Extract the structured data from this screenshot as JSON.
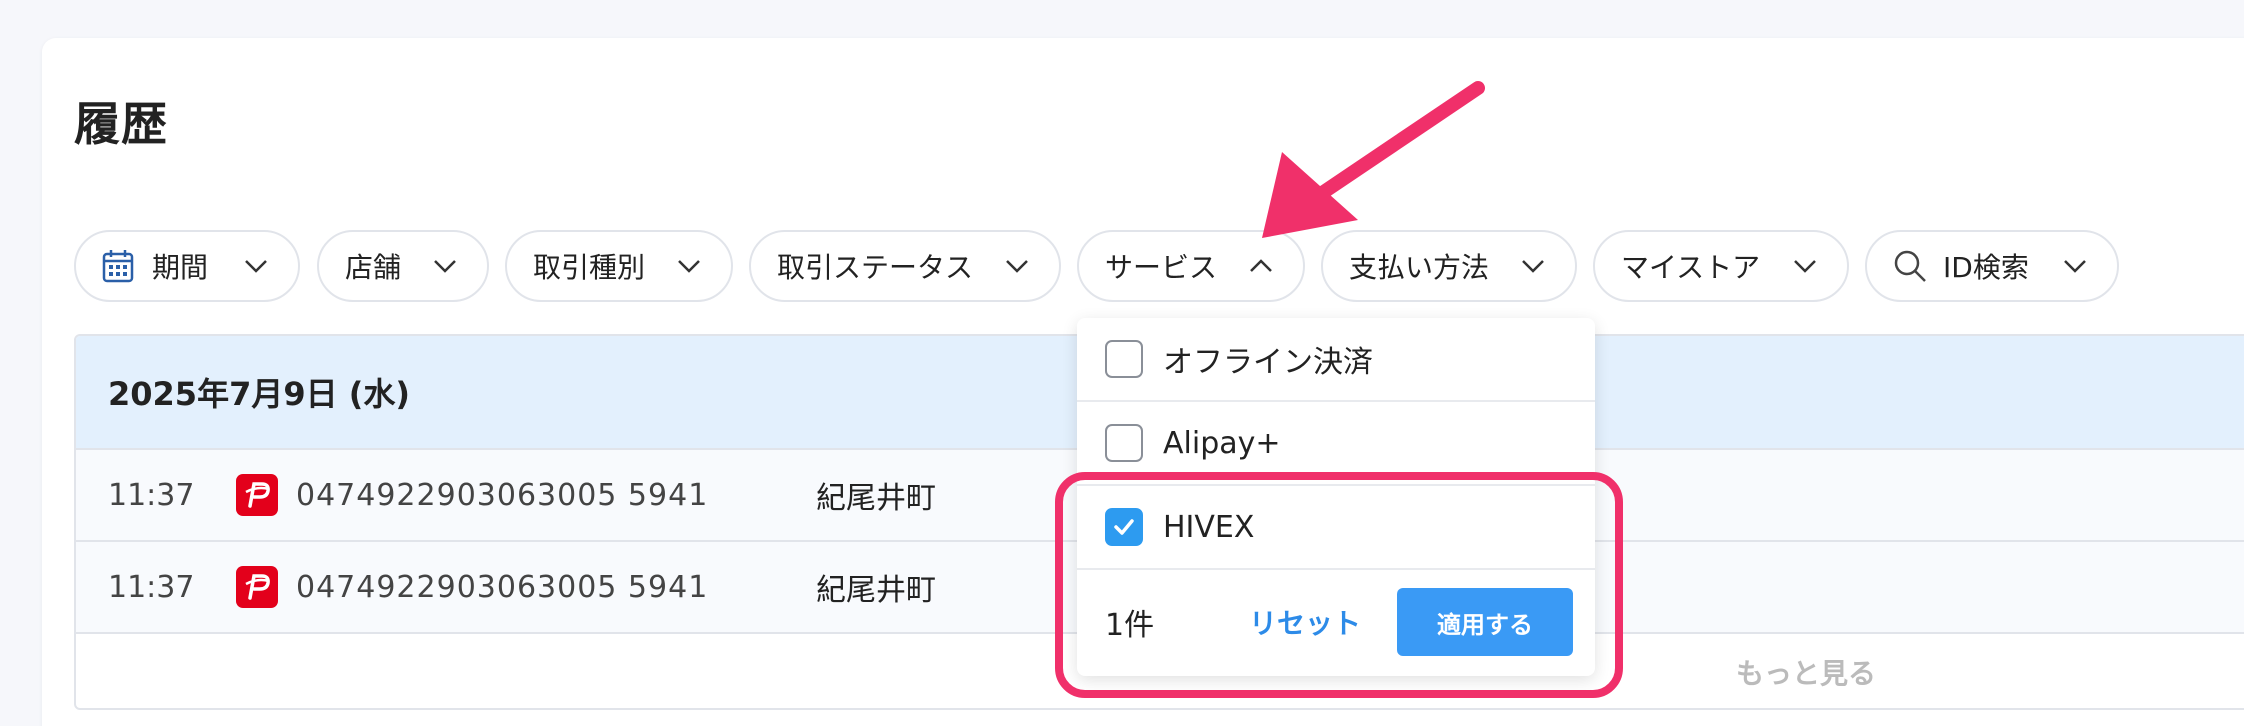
{
  "page": {
    "title": "履歴"
  },
  "filters": [
    {
      "label": "期間",
      "icon": "calendar-icon"
    },
    {
      "label": "店舗"
    },
    {
      "label": "取引種別"
    },
    {
      "label": "取引ステータス"
    },
    {
      "label": "サービス",
      "expanded": true
    },
    {
      "label": "支払い方法"
    },
    {
      "label": "マイストア"
    },
    {
      "label": "ID検索",
      "icon": "search-icon"
    }
  ],
  "history": {
    "date": "2025年7月9日 (水)",
    "rows": [
      {
        "time": "11:37",
        "payment_icon": "paypay-icon",
        "tx_id": "0474922903063005 5941",
        "store": "紀尾井町"
      },
      {
        "time": "11:37",
        "payment_icon": "paypay-icon",
        "tx_id": "0474922903063005 5941",
        "store": "紀尾井町"
      }
    ],
    "more_label": "もっと見る"
  },
  "service_dropdown": {
    "options": [
      {
        "label": "オフライン決済",
        "checked": false
      },
      {
        "label": "Alipay+",
        "checked": false
      },
      {
        "label": "HIVEX",
        "checked": true
      }
    ],
    "count_label": "1件",
    "reset_label": "リセット",
    "apply_label": "適用する"
  },
  "colors": {
    "accent": "#3a9af5",
    "annotation": "#f0306a",
    "date_header_bg": "#e3f0fd"
  }
}
